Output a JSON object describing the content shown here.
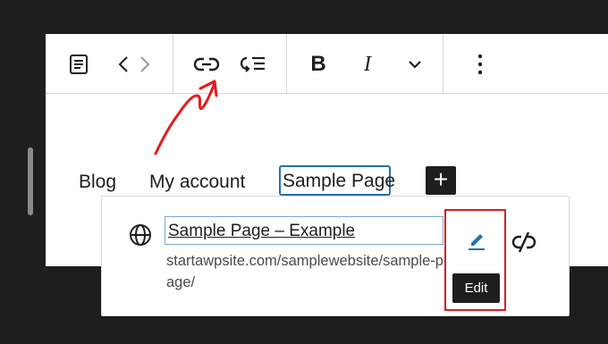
{
  "toolbar": {
    "buttons": [
      {
        "name": "page-icon"
      },
      {
        "name": "chevron-left-icon"
      },
      {
        "name": "chevron-right-icon"
      },
      {
        "name": "link-icon"
      },
      {
        "name": "submenu-icon"
      },
      {
        "name": "bold-icon",
        "label": "B"
      },
      {
        "name": "italic-icon",
        "label": "I"
      },
      {
        "name": "chevron-down-icon"
      },
      {
        "name": "more-options-icon"
      }
    ],
    "bold_label": "B",
    "italic_label": "I"
  },
  "nav": {
    "items": [
      "Blog",
      "My account",
      "Sample Page"
    ],
    "add_label": "+"
  },
  "link_popover": {
    "title": "Sample Page – Example",
    "url": "startawpsite.com/samplewebsite/sample-page/",
    "tooltip": "Edit"
  },
  "colors": {
    "annotation": "#e8191b",
    "selection_border": "#2271b1",
    "edit_highlight": "#d6221f",
    "edit_icon": "#2271b1"
  }
}
